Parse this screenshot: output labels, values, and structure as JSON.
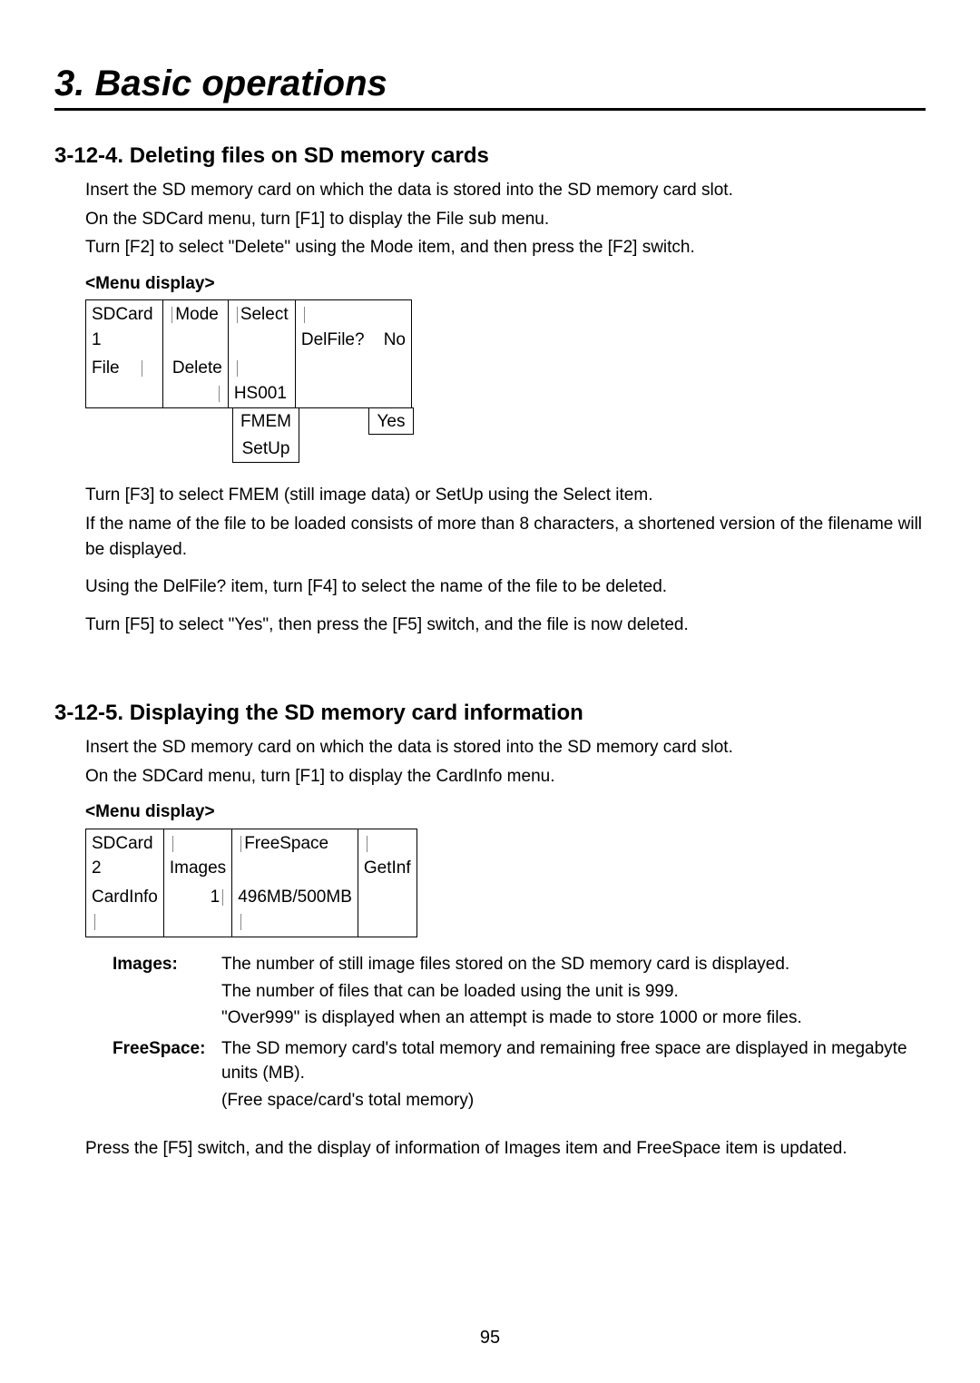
{
  "chapter_title": "3. Basic operations",
  "page_number": "95",
  "s1": {
    "heading": "3-12-4.  Deleting files on SD memory cards",
    "p1": "Insert the SD memory card on which the data is stored into the SD memory card slot.",
    "p2": "On the SDCard menu, turn [F1] to display the File sub menu.",
    "p3": "Turn [F2] to select \"Delete\" using the Mode item, and then press the [F2] switch.",
    "menu_label": "<Menu display>",
    "menu": {
      "r1c1": "SDCard 1",
      "r1c2": "Mode",
      "r1c3": "Select",
      "r1c4": "DelFile?",
      "r1c5": "No",
      "r2c1": "File",
      "r2c2": "Delete",
      "r2c3": "HS001",
      "opt1": "FMEM",
      "opt2": "SetUp",
      "opt_r": "Yes"
    },
    "p4a": "Turn [F3] to select FMEM (still image data) or SetUp using the Select item.",
    "p4b": "If the name of the file to be loaded consists of more than 8 characters, a shortened version of the filename will be displayed.",
    "p5": "Using the DelFile? item, turn [F4] to select the name of the file to be deleted.",
    "p6": "Turn [F5] to select \"Yes\", then press the [F5] switch, and the file is now deleted."
  },
  "s2": {
    "heading": "3-12-5.  Displaying the SD memory card information",
    "p1": "Insert the SD memory card on which the data is stored into the SD memory card slot.",
    "p2": "On the SDCard menu, turn [F1] to display the CardInfo menu.",
    "menu_label": "<Menu display>",
    "menu": {
      "r1c1": "SDCard 2",
      "r1c2": "Images",
      "r1c3": "FreeSpace",
      "r1c4": "GetInf",
      "r2c1": "CardInfo",
      "r2c2": "1",
      "r2c3": "496MB/500MB"
    },
    "defs": {
      "images_term": "Images:",
      "images_l1": "The number of still image files stored on the SD memory card is displayed.",
      "images_l2": "The number of files that can be loaded using the unit is 999.",
      "images_l3": "\"Over999\" is displayed when an attempt is made to store 1000 or more files.",
      "free_term": "FreeSpace:",
      "free_l1": "The SD memory card's total memory and remaining free space are displayed in megabyte units (MB).",
      "free_l2": "(Free space/card's total memory)"
    },
    "p3": "Press the [F5] switch, and the display of information of Images item and FreeSpace item is updated."
  }
}
